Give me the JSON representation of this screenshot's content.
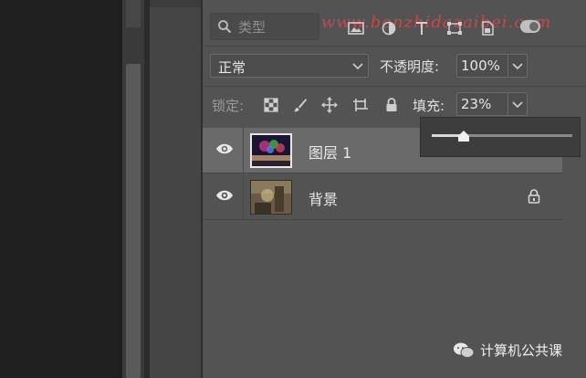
{
  "watermark": {
    "text": "www.benzhidazaibei.com"
  },
  "filter": {
    "search_placeholder": "类型",
    "icons": [
      "image-filter-icon",
      "adjustment-filter-icon",
      "type-filter-icon",
      "shape-filter-icon",
      "smart-object-filter-icon"
    ]
  },
  "blend": {
    "mode": "正常",
    "opacity_label": "不透明度:",
    "opacity_value": "100%"
  },
  "lock": {
    "label": "锁定:",
    "icons": [
      "lock-transparent-icon",
      "lock-paint-icon",
      "lock-move-icon",
      "lock-artboard-icon",
      "lock-all-icon"
    ],
    "fill_label": "填充:",
    "fill_value": "23%",
    "fill_fraction": 0.23
  },
  "layers": [
    {
      "name": "图层 1",
      "selected": true,
      "visible": true,
      "locked": false
    },
    {
      "name": "背景",
      "selected": false,
      "visible": true,
      "locked": true
    }
  ],
  "footer": {
    "channel": "计算机公共课"
  },
  "colors": {
    "panel_bg": "#535353",
    "selected_row": "#6a6a6a",
    "watermark": "#e24040"
  }
}
